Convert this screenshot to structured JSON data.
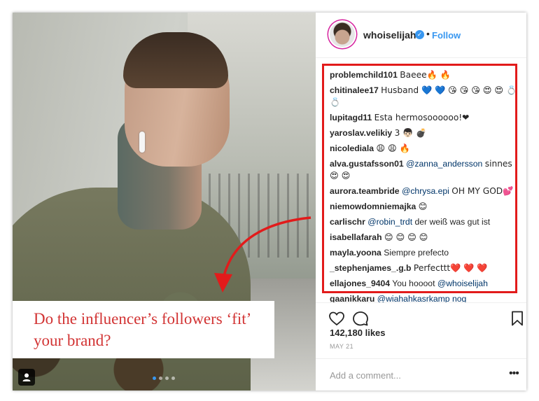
{
  "post": {
    "overlay_text": "Do the influencer’s followers ‘fit’ your brand?",
    "carousel": {
      "count": 4,
      "active_index": 0
    }
  },
  "header": {
    "username": "whoiselijah",
    "separator": "•",
    "follow_label": "Follow"
  },
  "comments": [
    {
      "user": "problemchild101",
      "text": "Baeee🔥 🔥"
    },
    {
      "user": "chitinalee17",
      "text": "Husband 💙 💙 😘 😘 😘 😍 😍 💍 💍"
    },
    {
      "user": "lupitagd11",
      "text": "Esta hermosoooooo!❤"
    },
    {
      "user": "yaroslav.velikiy",
      "text": "3 👦🏻 💣"
    },
    {
      "user": "nicolediala",
      "text": "😩 😩 🔥"
    },
    {
      "user": "alva.gustafsson01",
      "mention": "@zanna_andersson",
      "text": "sinnes😍 😍"
    },
    {
      "user": "aurora.teambride",
      "mention": "@chrysa.epi",
      "text": "OH MY GOD💕"
    },
    {
      "user": "niemowdomniemajka",
      "text": "😊"
    },
    {
      "user": "carlischr",
      "mention": "@robin_trdt",
      "text": "der weiß was gut ist"
    },
    {
      "user": "isabellafarah",
      "text": "😊 😊 😊 😊"
    },
    {
      "user": "mayla.yoona",
      "text": "Siempre prefecto"
    },
    {
      "user": "_stephenjames_.g.b",
      "text": "Perfecttt❤️ ❤️ ❤️"
    },
    {
      "user": "ellajones_9404",
      "text": "You hoooot",
      "mention_after": "@whoiselijah"
    },
    {
      "user": "gaanikkaru",
      "mention": "@wiahahkasrkamp nog",
      "text": ""
    }
  ],
  "actions": {
    "likes": "142,180 likes",
    "date": "MAY 21",
    "comment_placeholder": "Add a comment...",
    "more": "•••"
  },
  "colors": {
    "overlay_text": "#d23434",
    "highlight_box": "#e21b1b",
    "link_blue": "#3897f0",
    "mention": "#003569"
  },
  "icons": [
    "heart-icon",
    "comment-icon",
    "bookmark-icon",
    "verified-icon",
    "user-tag-icon",
    "more-icon"
  ]
}
